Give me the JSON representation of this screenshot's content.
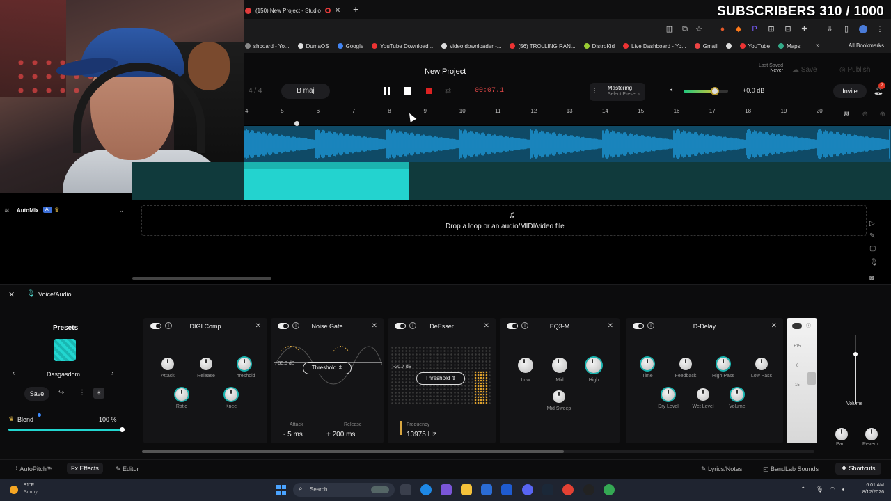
{
  "overlay": {
    "subscribers": "SUBSCRIBERS 310 / 1000"
  },
  "browser": {
    "tab_title": "(150) New Project - Studio",
    "new_tab": "+",
    "bookmarks": [
      {
        "label": "shboard - Yo...",
        "color": "#888"
      },
      {
        "label": "DumaOS",
        "color": "#ddd"
      },
      {
        "label": "Google",
        "color": "#4285f4"
      },
      {
        "label": "YouTube Download...",
        "color": "#e33"
      },
      {
        "label": "video downloader -...",
        "color": "#ddd"
      },
      {
        "label": "(56) TROLLING RAN...",
        "color": "#e33"
      },
      {
        "label": "DistroKid",
        "color": "#9c3"
      },
      {
        "label": "Live Dashboard - Yo...",
        "color": "#e33"
      },
      {
        "label": "Gmail",
        "color": "#e44"
      },
      {
        "label": "",
        "color": "#ddd"
      },
      {
        "label": "YouTube",
        "color": "#e33"
      },
      {
        "label": "Maps",
        "color": "#3a8"
      }
    ],
    "bookmarks_more": "»",
    "all_bookmarks": "All Bookmarks"
  },
  "studio": {
    "project_title": "New Project",
    "time_signature": "4 / 4",
    "key": "B maj",
    "time": "00:07.1",
    "mastering": {
      "title": "Mastering",
      "subtitle": "Select Preset ›"
    },
    "master_volume": 0.7,
    "master_db": "+0.0 dB",
    "last_saved_label": "Last Saved",
    "last_saved_value": "Never",
    "save_label": "Save",
    "publish_label": "Publish",
    "invite_label": "Invite",
    "notif_count": "2",
    "ruler": [
      "4",
      "5",
      "6",
      "7",
      "8",
      "9",
      "10",
      "11",
      "12",
      "13",
      "14",
      "15",
      "16",
      "17",
      "18",
      "19",
      "20"
    ],
    "automix": {
      "label": "AutoMix",
      "badge": "AI"
    },
    "drop_text": "Drop a loop or an audio/MIDI/video file"
  },
  "panel": {
    "title": "Voice/Audio",
    "presets_title": "Presets",
    "preset_name": "Dasgasdom",
    "save_label": "Save",
    "blend_label": "Blend",
    "blend_value_text": "100 %",
    "blend_value": 1.0,
    "effects": [
      {
        "name": "DIGI Comp",
        "knobs": [
          "Attack",
          "Release",
          "Threshold",
          "Ratio",
          "Knee"
        ]
      },
      {
        "name": "Noise Gate",
        "control": "Threshold",
        "value_label": "-33.8 dB",
        "attack_label": "Attack",
        "attack_value": "5 ms",
        "release_label": "Release",
        "release_value": "200 ms"
      },
      {
        "name": "DeEsser",
        "control": "Threshold",
        "value_label": "-20.7 dB",
        "freq_label": "Frequency",
        "freq_value": "13975 Hz"
      },
      {
        "name": "EQ3-M",
        "knobs": [
          "Low",
          "Mid",
          "High",
          "Mid Sweep"
        ]
      },
      {
        "name": "D-Delay",
        "knobs": [
          "Time",
          "Feedback",
          "High Pass",
          "Low Pass",
          "Dry Level",
          "Wet Level",
          "Volume"
        ]
      }
    ],
    "strip_scale": [
      "+15",
      "0",
      "-15",
      "-15"
    ],
    "volume_label": "Volume",
    "pan_label": "Pan",
    "reverb_label": "Reverb"
  },
  "bottom_bar": {
    "autopitch": "AutoPitch™",
    "effects": "Effects",
    "editor": "Editor",
    "lyrics": "Lyrics/Notes",
    "bandlab_sounds": "BandLab Sounds",
    "shortcuts": "Shortcuts"
  },
  "taskbar": {
    "weather_temp": "81°F",
    "weather_cond": "Sunny",
    "search": "Search",
    "time": "6:01 AM",
    "date": "8/12/2026"
  }
}
